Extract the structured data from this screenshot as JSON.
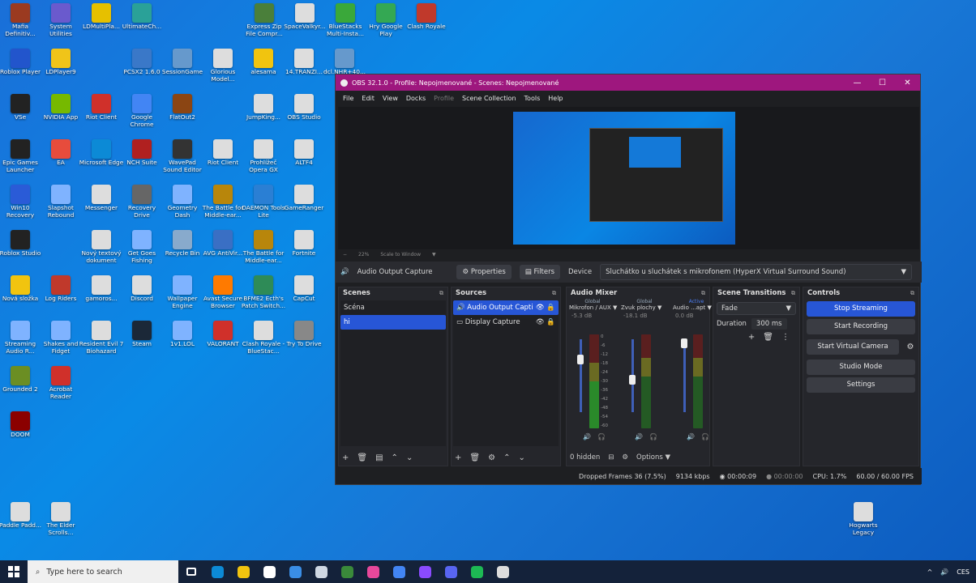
{
  "desktop": {
    "icons": [
      {
        "label": "Mafia Definitiv...",
        "color": "#9b3a20"
      },
      {
        "label": "System Utilities",
        "color": "#6a5acd"
      },
      {
        "label": "LDMultiPla...",
        "color": "#e6c000"
      },
      {
        "label": "UltimateCh...",
        "color": "#2aa198"
      },
      {
        "label": "Express Zip File Compr...",
        "color": "#4a7f3a"
      },
      {
        "label": "SpaceValkyr...",
        "color": "#dddddd"
      },
      {
        "label": "BlueStacks Multi-Insta...",
        "color": "#3aa83a"
      },
      {
        "label": "Hry Google Play",
        "color": "#34a853"
      },
      {
        "label": "Clash Royale",
        "color": "#c0392b"
      },
      {
        "label": "Roblox Player",
        "color": "#2255cc"
      },
      {
        "label": "LDPlayer9",
        "color": "#f0c419"
      },
      {
        "label": "PCSX2 1.6.0",
        "color": "#3a78c8"
      },
      {
        "label": "SessionGame",
        "color": "#6699cc"
      },
      {
        "label": "Glorious Model...",
        "color": "#dddddd"
      },
      {
        "label": "alesama",
        "color": "#f1c40f"
      },
      {
        "label": "14.TRANZI...",
        "color": "#dddddd"
      },
      {
        "label": "dcl.NHR+40...",
        "color": "#6699cc"
      },
      {
        "label": "VSe",
        "color": "#222222"
      },
      {
        "label": "NVIDIA App",
        "color": "#76b900"
      },
      {
        "label": "Riot Client",
        "color": "#d0302a"
      },
      {
        "label": "Google Chrome",
        "color": "#4285f4"
      },
      {
        "label": "FlatOut2",
        "color": "#8b4513"
      },
      {
        "label": "JumpKing...",
        "color": "#dddddd"
      },
      {
        "label": "OBS Studio",
        "color": "#dddddd"
      },
      {
        "label": "Epic Games Launcher",
        "color": "#222222"
      },
      {
        "label": "EA",
        "color": "#e74c3c"
      },
      {
        "label": "Microsoft Edge",
        "color": "#0c8ad6"
      },
      {
        "label": "NCH Suite",
        "color": "#b02020"
      },
      {
        "label": "WavePad Sound Editor",
        "color": "#333333"
      },
      {
        "label": "Riot Client",
        "color": "#dddddd"
      },
      {
        "label": "Prohlížeč Opera GX",
        "color": "#dddddd"
      },
      {
        "label": "ALTF4",
        "color": "#dddddd"
      },
      {
        "label": "Win10 Recovery",
        "color": "#2a5bd7"
      },
      {
        "label": "Slapshot Rebound",
        "color": "#7fb3ff"
      },
      {
        "label": "Messenger",
        "color": "#dddddd"
      },
      {
        "label": "Recovery Drive",
        "color": "#666666"
      },
      {
        "label": "Geometry Dash",
        "color": "#7fb3ff"
      },
      {
        "label": "The Battle for Middle-ear...",
        "color": "#b8860b"
      },
      {
        "label": "DAEMON Tools Lite",
        "color": "#2a7fd4"
      },
      {
        "label": "GameRanger",
        "color": "#dddddd"
      },
      {
        "label": "Roblox Studio",
        "color": "#222222"
      },
      {
        "label": "Nový textový dokument",
        "color": "#dddddd"
      },
      {
        "label": "Get Goes Fishing",
        "color": "#7fb3ff"
      },
      {
        "label": "Recycle Bin",
        "color": "#88aacc"
      },
      {
        "label": "AVG AntiVir...",
        "color": "#3a6fc4"
      },
      {
        "label": "The Battle for Middle-ear...",
        "color": "#b8860b"
      },
      {
        "label": "Fortnite",
        "color": "#dddddd"
      },
      {
        "label": "Nová složka",
        "color": "#f1c40f"
      },
      {
        "label": "Log Riders",
        "color": "#c0392b"
      },
      {
        "label": "gamoros...",
        "color": "#dddddd"
      },
      {
        "label": "Discord",
        "color": "#dddddd"
      },
      {
        "label": "Wallpaper Engine",
        "color": "#7fb3ff"
      },
      {
        "label": "Avast Secure Browser",
        "color": "#ff7a00"
      },
      {
        "label": "BFME2 Ecth's Patch Switch...",
        "color": "#2e8b57"
      },
      {
        "label": "CapCut",
        "color": "#dddddd"
      },
      {
        "label": "Streaming Audio R...",
        "color": "#7fb3ff"
      },
      {
        "label": "Shakes and Fidget",
        "color": "#7fb3ff"
      },
      {
        "label": "Resident Evil 7 Biohazard",
        "color": "#dddddd"
      },
      {
        "label": "Steam",
        "color": "#1b2838"
      },
      {
        "label": "1v1.LOL",
        "color": "#7fb3ff"
      },
      {
        "label": "VALORANT",
        "color": "#d0302a"
      },
      {
        "label": "Clash Royale - BlueStac...",
        "color": "#dddddd"
      },
      {
        "label": "Try To Drive",
        "color": "#888888"
      },
      {
        "label": "Grounded 2",
        "color": "#6b8e23"
      },
      {
        "label": "Acrobat Reader",
        "color": "#d0302a"
      },
      {
        "label": "DOOM",
        "color": "#8b0000"
      },
      {
        "label": "Paddle Padd...",
        "color": "#dddddd"
      },
      {
        "label": "The Elder Scrolls...",
        "color": "#dddddd"
      },
      {
        "label": "Hogwarts Legacy",
        "color": "#dddddd"
      }
    ]
  },
  "obs": {
    "title": "OBS 32.1.0 - Profile: Nepojmenované - Scenes: Nepojmenované",
    "window_buttons": {
      "minimize": "—",
      "maximize": "☐",
      "close": "✕"
    },
    "menu": [
      "File",
      "Edit",
      "View",
      "Docks",
      "Profile",
      "Scene Collection",
      "Tools",
      "Help"
    ],
    "zoom": {
      "percent": "22%",
      "mode": "Scale to Window"
    },
    "context": {
      "source": "Audio Output Capture",
      "properties": "Properties",
      "filters": "Filters",
      "device_label": "Device",
      "device_value": "Sluchátko u sluchátek s mikrofonem (HyperX Virtual Surround Sound)"
    },
    "scenes": {
      "title": "Scenes",
      "items": [
        {
          "label": "Scéna",
          "selected": false
        },
        {
          "label": "hi",
          "selected": true
        }
      ]
    },
    "sources": {
      "title": "Sources",
      "items": [
        {
          "label": "Audio Output Capti",
          "selected": true
        },
        {
          "label": "Display Capture",
          "selected": false
        }
      ]
    },
    "mixer": {
      "title": "Audio Mixer",
      "channels": [
        {
          "scope": "Global",
          "name": "Mikrofon / AUX",
          "db": "-5.3 dB",
          "level": 0.72
        },
        {
          "scope": "Global",
          "name": "Zvuk plochy",
          "db": "-18.1 dB",
          "level": 0.45
        },
        {
          "scope": "Active",
          "name": "Audio ...apt",
          "db": "0.0 dB",
          "level": 0.95
        }
      ],
      "ticks": [
        "0",
        "-6",
        "-12",
        "-18",
        "-24",
        "-30",
        "-36",
        "-42",
        "-48",
        "-54",
        "-60"
      ],
      "hidden": "0 hidden",
      "options": "Options"
    },
    "transitions": {
      "title": "Scene Transitions",
      "type": "Fade",
      "duration_label": "Duration",
      "duration_value": "300 ms"
    },
    "controls": {
      "title": "Controls",
      "buttons": [
        "Stop Streaming",
        "Start Recording",
        "Start Virtual Camera",
        "Studio Mode",
        "Settings"
      ]
    },
    "status": {
      "dropped": "Dropped Frames 36 (7.5%)",
      "bitrate": "9134 kbps",
      "stream_time": "00:00:09",
      "rec_time": "00:00:00",
      "cpu": "CPU: 1.7%",
      "fps": "60.00 / 60.00 FPS"
    }
  },
  "taskbar": {
    "search_placeholder": "Type here to search",
    "apps": [
      {
        "name": "task-view",
        "color": "#ffffff"
      },
      {
        "name": "edge",
        "color": "#0c8ad6"
      },
      {
        "name": "file-explorer",
        "color": "#f1c40f"
      },
      {
        "name": "store",
        "color": "#ffffff"
      },
      {
        "name": "mail",
        "color": "#3a8ee6"
      },
      {
        "name": "steam",
        "color": "#cfd8e3"
      },
      {
        "name": "minecraft",
        "color": "#3a8a3a"
      },
      {
        "name": "feather",
        "color": "#e8489b"
      },
      {
        "name": "chrome",
        "color": "#4285f4"
      },
      {
        "name": "messenger",
        "color": "#8a4bff"
      },
      {
        "name": "discord",
        "color": "#5865f2"
      },
      {
        "name": "spotify",
        "color": "#1db954"
      },
      {
        "name": "obs",
        "color": "#dddddd"
      }
    ],
    "language": "CES"
  }
}
